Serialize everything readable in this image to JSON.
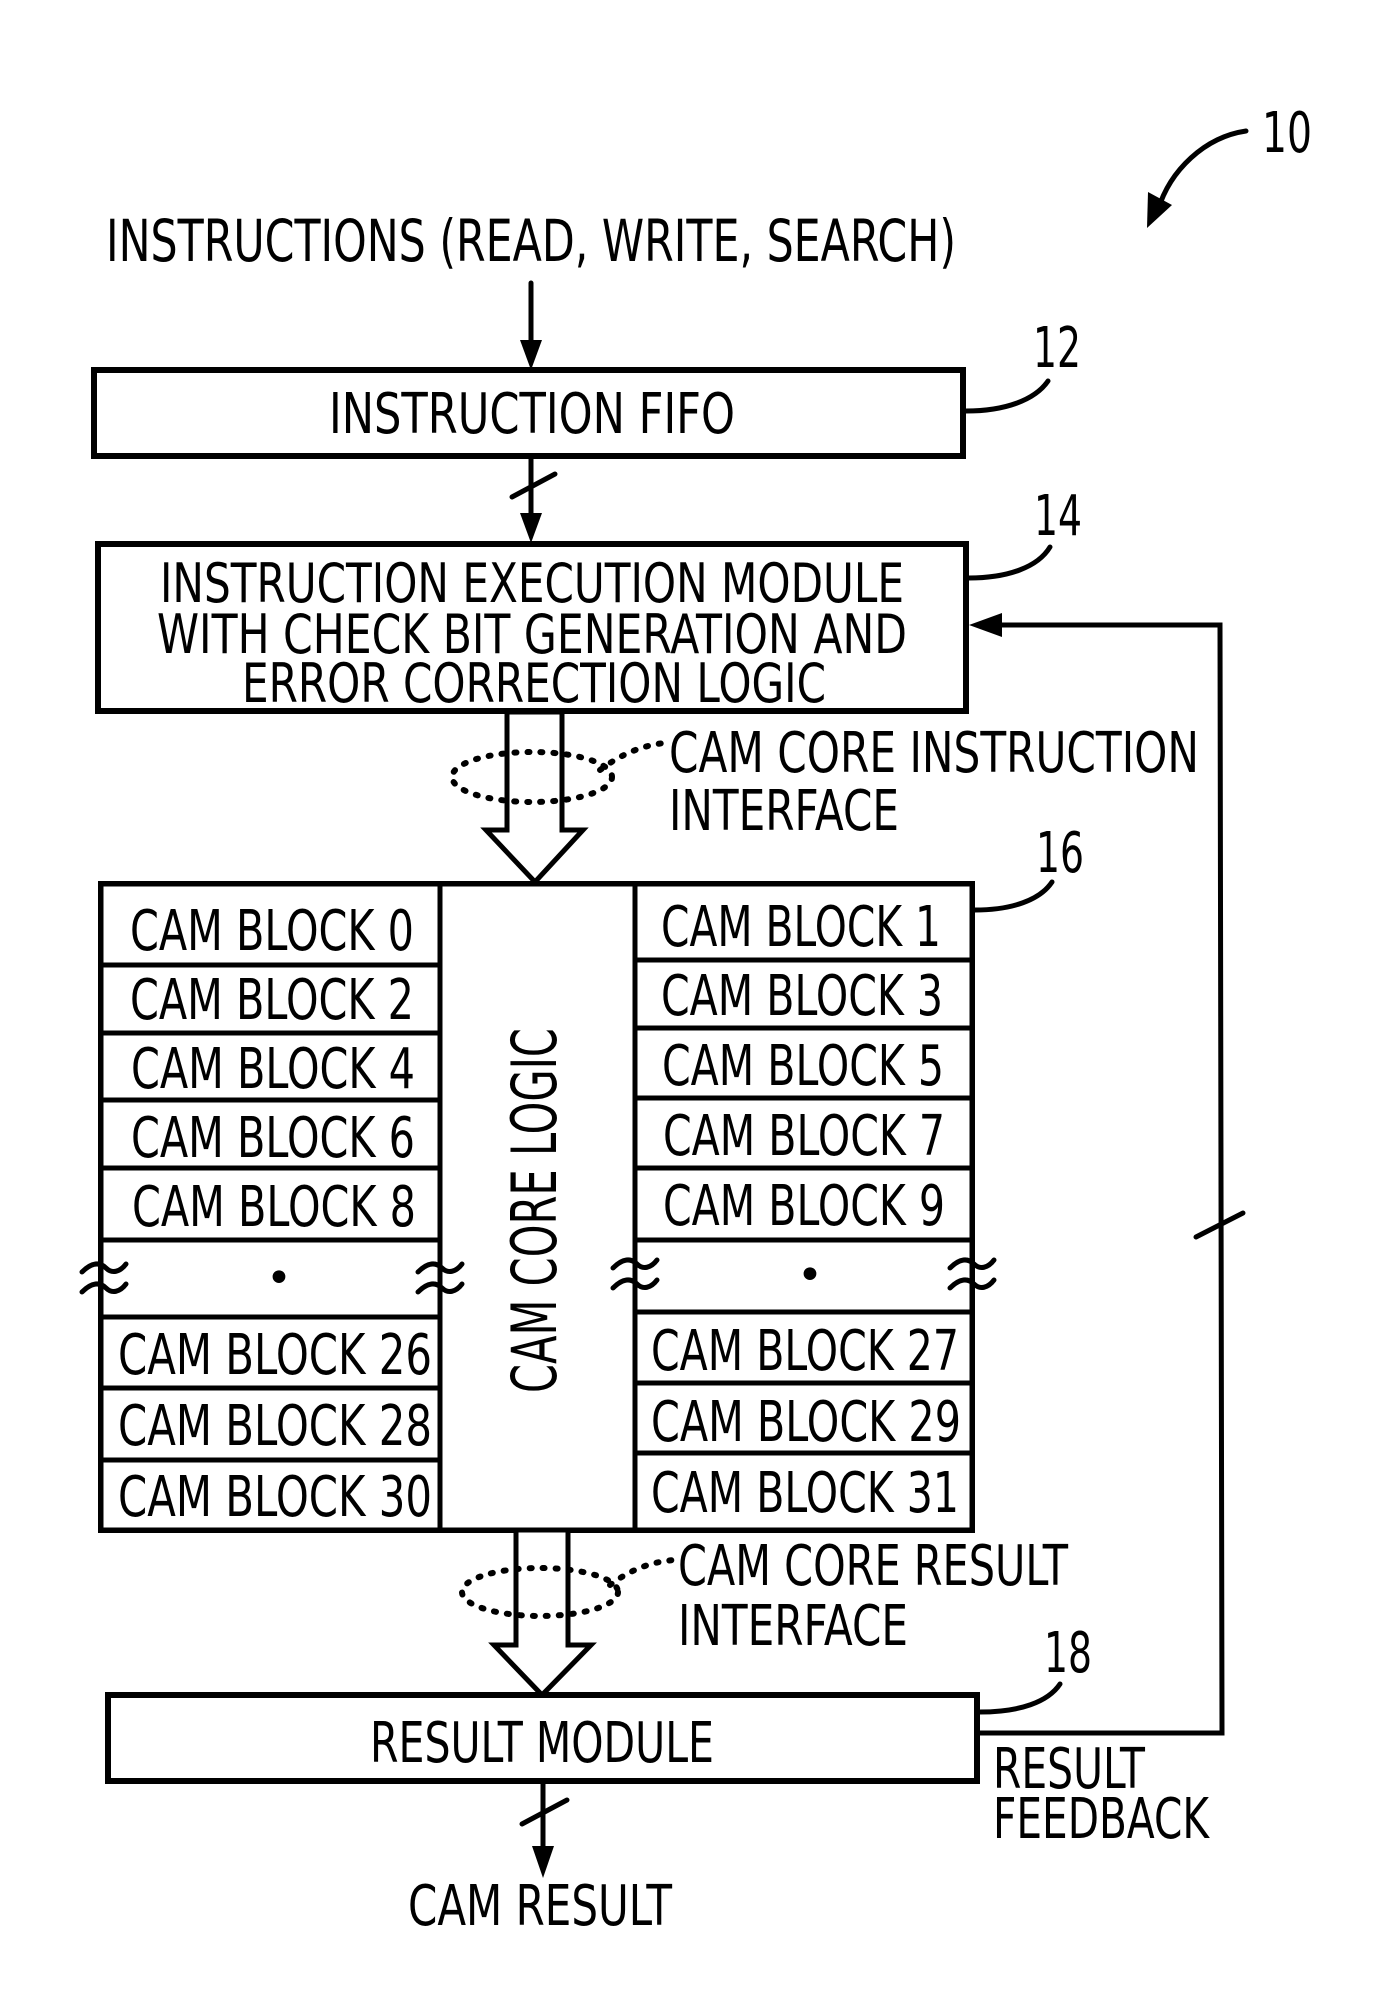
{
  "figure": {
    "reference_numeral": "10",
    "input_label": "INSTRUCTIONS (READ, WRITE, SEARCH)",
    "output_label": "CAM RESULT"
  },
  "instruction_fifo": {
    "label": "INSTRUCTION FIFO",
    "numeral": "12"
  },
  "execution_module": {
    "lines": [
      "INSTRUCTION EXECUTION MODULE",
      "WITH CHECK BIT GENERATION AND",
      "ERROR CORRECTION LOGIC"
    ],
    "numeral": "14"
  },
  "instruction_interface": {
    "lines": [
      "CAM CORE INSTRUCTION",
      "INTERFACE"
    ]
  },
  "cam_core": {
    "numeral": "16",
    "core_logic_label": "CAM CORE LOGIC",
    "left_blocks_top": [
      "CAM BLOCK 0",
      "CAM BLOCK 2",
      "CAM BLOCK 4",
      "CAM BLOCK 6",
      "CAM BLOCK 8"
    ],
    "right_blocks_top": [
      "CAM BLOCK 1",
      "CAM BLOCK 3",
      "CAM BLOCK 5",
      "CAM BLOCK 7",
      "CAM BLOCK 9"
    ],
    "ellipsis": "•",
    "left_blocks_bottom": [
      "CAM BLOCK 26",
      "CAM BLOCK 28",
      "CAM BLOCK 30"
    ],
    "right_blocks_bottom": [
      "CAM BLOCK 27",
      "CAM BLOCK 29",
      "CAM BLOCK 31"
    ]
  },
  "result_interface": {
    "lines": [
      "CAM CORE RESULT",
      "INTERFACE"
    ]
  },
  "result_module": {
    "label": "RESULT MODULE",
    "numeral": "18"
  },
  "feedback": {
    "lines": [
      "RESULT",
      "FEEDBACK"
    ]
  }
}
